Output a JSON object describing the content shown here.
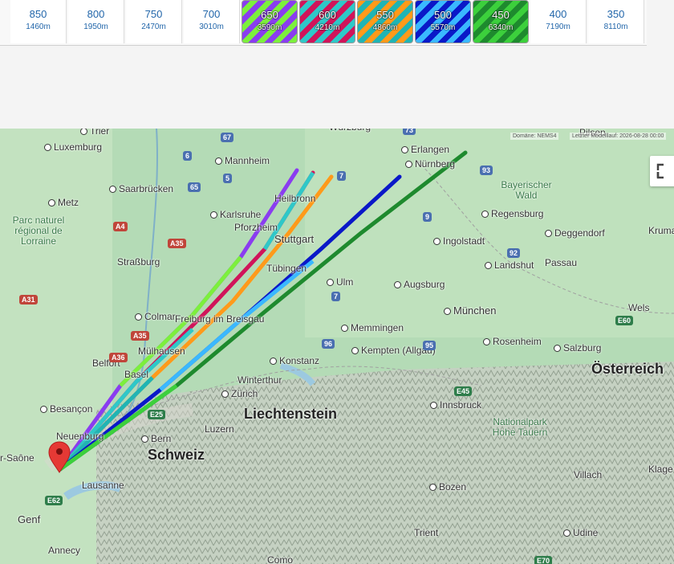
{
  "levels": [
    {
      "hpa": "850",
      "alt": "1460m",
      "selected": false
    },
    {
      "hpa": "800",
      "alt": "1950m",
      "selected": false
    },
    {
      "hpa": "750",
      "alt": "2470m",
      "selected": false
    },
    {
      "hpa": "700",
      "alt": "3010m",
      "selected": false
    },
    {
      "hpa": "650",
      "alt": "3590m",
      "selected": true,
      "colors": [
        "#8a3cf0",
        "#7cf03c"
      ]
    },
    {
      "hpa": "600",
      "alt": "4210m",
      "selected": true,
      "colors": [
        "#d0145a",
        "#2ec8c8"
      ]
    },
    {
      "hpa": "550",
      "alt": "4860m",
      "selected": true,
      "colors": [
        "#ff9a1a",
        "#20b4b4"
      ]
    },
    {
      "hpa": "500",
      "alt": "5570m",
      "selected": true,
      "colors": [
        "#0a18c8",
        "#3ab8ff"
      ]
    },
    {
      "hpa": "450",
      "alt": "6340m",
      "selected": true,
      "colors": [
        "#1e8a2e",
        "#3cd03c"
      ]
    },
    {
      "hpa": "400",
      "alt": "7190m",
      "selected": false
    },
    {
      "hpa": "350",
      "alt": "8110m",
      "selected": false
    }
  ],
  "map": {
    "credit_domain": "Domäne: NEMS4",
    "credit_run": "Letzter Modelllauf: 2026-08-28 00:00",
    "labels": {
      "trier": "Trier",
      "luxemburg": "Luxemburg",
      "saarbruecken": "Saarbrücken",
      "metz": "Metz",
      "parc": "Parc naturel régional de Lorraine",
      "karlsruhe": "Karlsruhe",
      "mannheim": "Mannheim",
      "wuerzburg": "Würzburg",
      "pforzheim": "Pforzheim",
      "heilbronn": "Heilbronn",
      "stuttgart": "Stuttgart",
      "tuebingen": "Tübingen",
      "strassburg": "Straßburg",
      "colmar": "Colmar",
      "freiburg": "Freiburg im Breisgau",
      "muelhausen": "Mülhausen",
      "basel": "Basel",
      "belfort": "Belfort",
      "besancon": "Besançon",
      "erlangen": "Erlangen",
      "nuernberg": "Nürnberg",
      "bayerischer_wald": "Bayerischer Wald",
      "regensburg": "Regensburg",
      "deggendorf": "Deggendorf",
      "ingolstadt": "Ingolstadt",
      "landshut": "Landshut",
      "passau": "Passau",
      "ulm": "Ulm",
      "augsburg": "Augsburg",
      "muenchen": "München",
      "memmingen": "Memmingen",
      "kempten": "Kempten (Allgäu)",
      "rosenheim": "Rosenheim",
      "salzburg": "Salzburg",
      "wels": "Wels",
      "konstanz": "Konstanz",
      "winterthur": "Winterthur",
      "zuerich": "Zürich",
      "liechtenstein": "Liechtenstein",
      "luzern": "Luzern",
      "bern": "Bern",
      "schweiz": "Schweiz",
      "neuenburg": "Neuenburg",
      "lausanne": "Lausanne",
      "genf": "Genf",
      "annecy": "Annecy",
      "saone": "r-Saône",
      "innsbruck": "Innsbruck",
      "bozen": "Bozen",
      "trient": "Trient",
      "como": "Como",
      "udine": "Udine",
      "villach": "Villach",
      "oesterreich": "Österreich",
      "np_hohe_tauern": "Nationalpark Hohe Tauern",
      "klagenfurt": "Klage",
      "krumau": "Kruma",
      "pilsen": "Pilsen"
    },
    "roads": [
      "67",
      "73",
      "6",
      "65",
      "7",
      "5",
      "93",
      "9",
      "92",
      "A4",
      "A35",
      "A31",
      "A35",
      "A36",
      "96",
      "95",
      "7",
      "E45",
      "E25",
      "E62",
      "E60",
      "E70"
    ]
  }
}
